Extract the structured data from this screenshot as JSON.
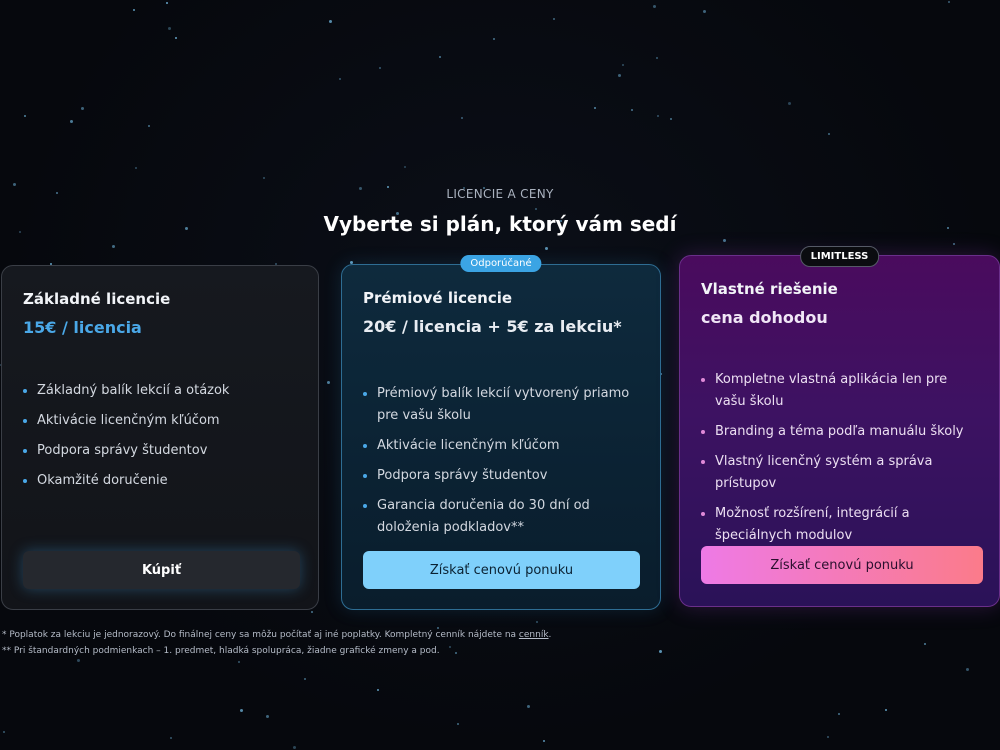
{
  "section": {
    "eyebrow": "LICENCIE A CENY",
    "heading": "Vyberte si plán, ktorý vám sedí"
  },
  "plans": [
    {
      "title": "Základné licencie",
      "price": "15€ / licencia",
      "features": [
        "Základný balík lekcií a otázok",
        "Aktivácie licenčným kľúčom",
        "Podpora správy študentov",
        "Okamžité doručenie"
      ],
      "cta": "Kúpiť"
    },
    {
      "badge": "Odporúčané",
      "title": "Prémiové licencie",
      "price": "20€ / licencia + 5€ za lekciu*",
      "features": [
        "Prémiový balík lekcií vytvorený priamo pre vašu školu",
        "Aktivácie licenčným kľúčom",
        "Podpora správy študentov",
        "Garancia doručenia do 30 dní od doloženia podkladov**"
      ],
      "cta": "Získať cenovú ponuku"
    },
    {
      "badge": "LIMITLESS",
      "title": "Vlastné riešenie",
      "price": "cena dohodou",
      "features": [
        "Kompletne vlastná aplikácia len pre vašu školu",
        "Branding a téma podľa manuálu školy",
        "Vlastný licenčný systém a správa prístupov",
        "Možnosť rozšírení, integrácií a špeciálnych modulov"
      ],
      "cta": "Získať cenovú ponuku"
    }
  ],
  "footnotes": {
    "note1_text": "* Poplatok za lekciu je jednorazový. Do finálnej ceny sa môžu počítať aj iné poplatky. Kompletný cenník nájdete na ",
    "note1_link": "cenník",
    "note1_end": ".",
    "note2": "** Pri štandardných podmienkach – 1. predmet, hladká spolupráca, žiadne grafické zmeny a pod."
  },
  "colors": {
    "accent_blue": "#4aa8e8",
    "premium_button": "#7fd0fb",
    "custom_gradient_start": "#ee7ae6",
    "custom_gradient_end": "#fb7b8a"
  }
}
